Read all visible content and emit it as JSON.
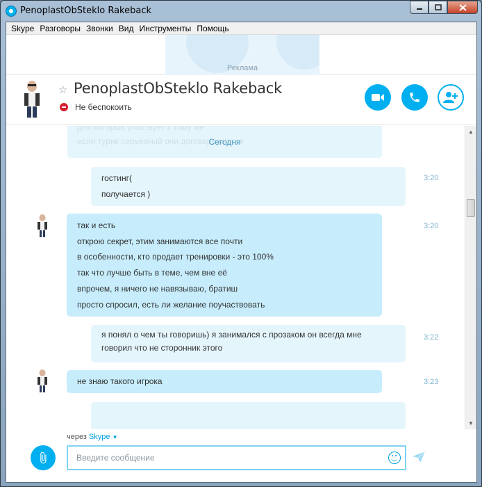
{
  "window": {
    "title": "PenoplastObSteklo Rakeback"
  },
  "menu": [
    {
      "label": "Skype"
    },
    {
      "label": "Разговоры"
    },
    {
      "label": "Звонки"
    },
    {
      "label": "Вид"
    },
    {
      "label": "Инструменты"
    },
    {
      "label": "Помощь"
    }
  ],
  "ad": {
    "label": "Реклама"
  },
  "contact": {
    "name": "PenoplastObSteklo Rakeback",
    "status": "Не беспокоить"
  },
  "conversation": {
    "date_label": "Сегодня",
    "ghost_lines": [
      "для которых участвует к тому же",
      "если турик серьезный они договариваются"
    ],
    "messages": [
      {
        "direction": "out",
        "time": "3:20",
        "lines": [
          "гостинг(",
          "получается )"
        ]
      },
      {
        "direction": "in",
        "time": "3:20",
        "lines": [
          "так и есть",
          "открою секрет, этим занимаются все почти",
          "в особенности, кто продает тренировки - это 100%",
          "так что лучше быть в теме, чем вне её",
          "впрочем, я ничего не навязываю, братиш",
          "просто спросил, есть ли желание поучаствовать"
        ]
      },
      {
        "direction": "out",
        "time": "3:22",
        "lines": [
          "я понял о чем ты говоришь) я занимался с прозаком он всегда мне",
          "говорил что не сторонник этого"
        ]
      },
      {
        "direction": "in",
        "time": "3:23",
        "lines": [
          "не знаю такого игрока"
        ]
      }
    ]
  },
  "compose": {
    "via_prefix": "через",
    "via_service": "Skype",
    "placeholder": "Введите сообщение"
  },
  "colors": {
    "accent": "#00aff0",
    "incoming_bubble": "#c7edfc",
    "outgoing_bubble": "#e4f5fc",
    "dnd_status": "#d4202f"
  }
}
